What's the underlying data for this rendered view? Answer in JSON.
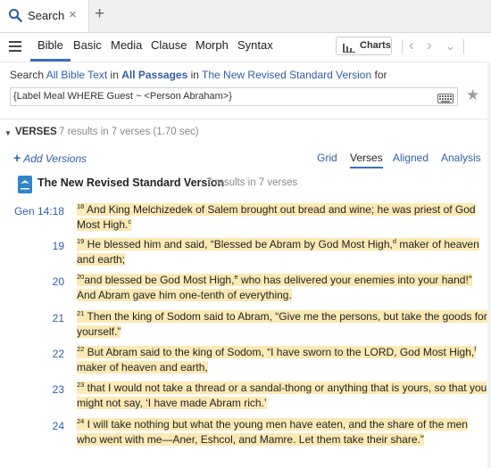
{
  "tab": {
    "label": "Search",
    "close": "×",
    "new_tab": "+"
  },
  "toolbar": {
    "modes": [
      "Bible",
      "Basic",
      "Media",
      "Clause",
      "Morph",
      "Syntax"
    ],
    "active_mode": "Bible",
    "charts_label": "Charts",
    "back_arrow": "‹",
    "forward_arrow": "›",
    "menu_arrow": "›"
  },
  "search": {
    "prefix": "Search ",
    "what": "All Bible Text",
    "in1": " in ",
    "where": "All Passages",
    "in2": " in ",
    "version": "The New Revised Standard Version",
    "suffix": " for",
    "query": "{Label Meal  WHERE Guest ~ <Person Abraham>}",
    "star": "★"
  },
  "results": {
    "section_label": "VERSES",
    "count_text": "7 results in 7 verses (1.70 sec)",
    "add_versions": "Add Versions",
    "add_plus": "+",
    "views": [
      "Grid",
      "Verses",
      "Aligned",
      "Analysis"
    ],
    "active_view": "Verses",
    "version_name": "The New Revised Standard Version",
    "version_count": "7 results in 7 verses",
    "version_color": "#2f86c8"
  },
  "verses": [
    {
      "ref": "Gen 14:18",
      "n": "18",
      "text": " And King Melchizedek of Salem brought out bread and wine; he was priest of God Most High.",
      "note": "c",
      "after": ""
    },
    {
      "ref": "19",
      "n": "19",
      "text": " He blessed him and said, “Blessed be Abram by God Most High,",
      "note": "d",
      "after": " maker of heaven and earth;"
    },
    {
      "ref": "20",
      "n": "20",
      "text": "and blessed be God Most High,",
      "note": "e",
      "after": " who has delivered your enemies into your hand!” And Abram gave him one-tenth of everything."
    },
    {
      "ref": "21",
      "n": "21",
      "text": " Then the king of Sodom said to Abram, “Give me the persons, but take the goods for yourself.”",
      "note": "",
      "after": ""
    },
    {
      "ref": "22",
      "n": "22",
      "text": " But Abram said to the king of Sodom, “I have sworn to the LORD, God Most High,",
      "note": "f",
      "after": " maker of heaven and earth,"
    },
    {
      "ref": "23",
      "n": "23",
      "text": " that I would not take a thread or a sandal-thong or anything that is yours, so that you might not say, ‘I have made Abram rich.’",
      "note": "",
      "after": ""
    },
    {
      "ref": "24",
      "n": "24",
      "text": " I will take nothing but what the young men have eaten, and the share of the men who went with me—Aner, Eshcol, and Mamre. Let them take their share.”",
      "note": "",
      "after": ""
    }
  ],
  "colors": {
    "highlight": "#fde9b4",
    "link": "#2e5fa8",
    "accent": "#3b6fbf"
  }
}
